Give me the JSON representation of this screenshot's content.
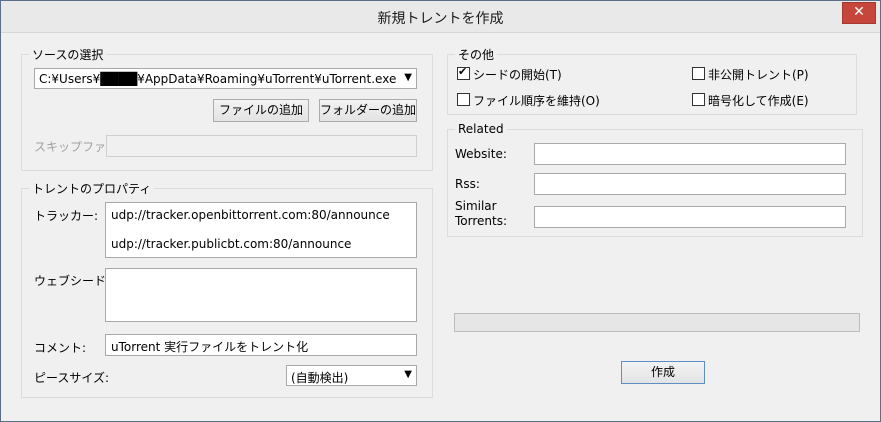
{
  "window": {
    "title": "新規トレントを作成",
    "close": "✕"
  },
  "source": {
    "legend": "ソースの選択",
    "path": "C:¥Users¥████¥AppData¥Roaming¥uTorrent¥uTorrent.exe",
    "add_file": "ファイルの追加",
    "add_folder": "フォルダーの追加",
    "skip_label": "スキップファイ"
  },
  "props": {
    "legend": "トレントのプロパティ",
    "tracker_label": "トラッカー:",
    "trackers": [
      "udp://tracker.openbittorrent.com:80/announce",
      "udp://tracker.publicbt.com:80/announce"
    ],
    "webseed_label": "ウェブシード:",
    "comment_label": "コメント:",
    "comment_value": "uTorrent 実行ファイルをトレント化",
    "piece_label": "ピースサイズ:",
    "piece_value": "(自動検出)"
  },
  "other": {
    "legend": "その他",
    "start_seeding": "シードの開始(T)",
    "private": "非公開トレント(P)",
    "preserve_order": "ファイル順序を維持(O)",
    "encrypt": "暗号化して作成(E)",
    "start_seeding_checked": true,
    "private_checked": false,
    "preserve_order_checked": false,
    "encrypt_checked": false
  },
  "related": {
    "legend": "Related",
    "website_label": "Website:",
    "rss_label": "Rss:",
    "similar_label_1": "Similar",
    "similar_label_2": "Torrents:"
  },
  "create_button": "作成",
  "progress": 0
}
